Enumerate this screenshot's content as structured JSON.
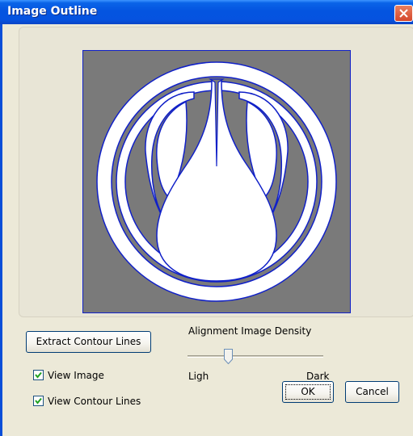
{
  "window": {
    "title": "Image Outline"
  },
  "buttons": {
    "extract_label": "Extract Contour Lines",
    "ok_label": "OK",
    "cancel_label": "Cancel"
  },
  "checkboxes": {
    "view_image": {
      "label": "View Image",
      "checked": true
    },
    "view_contour_lines": {
      "label": "View Contour Lines",
      "checked": true
    }
  },
  "density": {
    "title": "Alignment Image Density",
    "min_label": "Ligh",
    "max_label": "Dark",
    "value": 0.3
  },
  "colors": {
    "title_bar": "#0a5ae6",
    "dialog_background": "#ece9d8",
    "image_background": "#7a7a7a",
    "contour_line": "#1020c8",
    "image_foreground": "#ffffff"
  },
  "icons": {
    "close": "close-icon",
    "checkmark": "checkmark-icon"
  }
}
